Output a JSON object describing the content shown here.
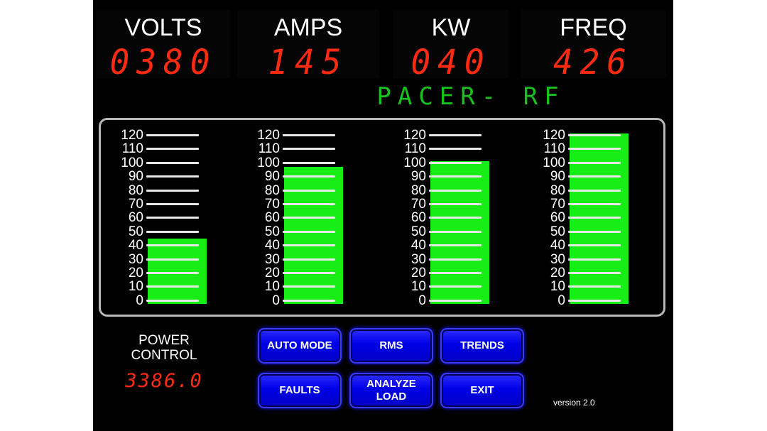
{
  "readouts": [
    {
      "label": "VOLTS",
      "value": "0380"
    },
    {
      "label": "AMPS",
      "value": "145"
    },
    {
      "label": "KW",
      "value": "040"
    },
    {
      "label": "FREQ",
      "value": "426"
    }
  ],
  "title": "PACER- RF",
  "meters": {
    "ticks": [
      "120",
      "110",
      "100",
      "90",
      "80",
      "70",
      "60",
      "50",
      "40",
      "30",
      "20",
      "10",
      "0"
    ],
    "levels": [
      45,
      97,
      101,
      121
    ]
  },
  "power_control": {
    "label_line1": "POWER",
    "label_line2": "CONTROL",
    "value": "3386.0"
  },
  "buttons": {
    "auto_mode": "AUTO MODE",
    "rms": "RMS",
    "trends": "TRENDS",
    "faults": "FAULTS",
    "analyze_load": "ANALYZE\nLOAD",
    "exit": "EXIT"
  },
  "version": "version 2.0",
  "colors": {
    "background": "#000000",
    "led_red": "#ff2a12",
    "title_green": "#18c21c",
    "bar_green": "#16ee16",
    "button_blue": "#0000e6"
  }
}
